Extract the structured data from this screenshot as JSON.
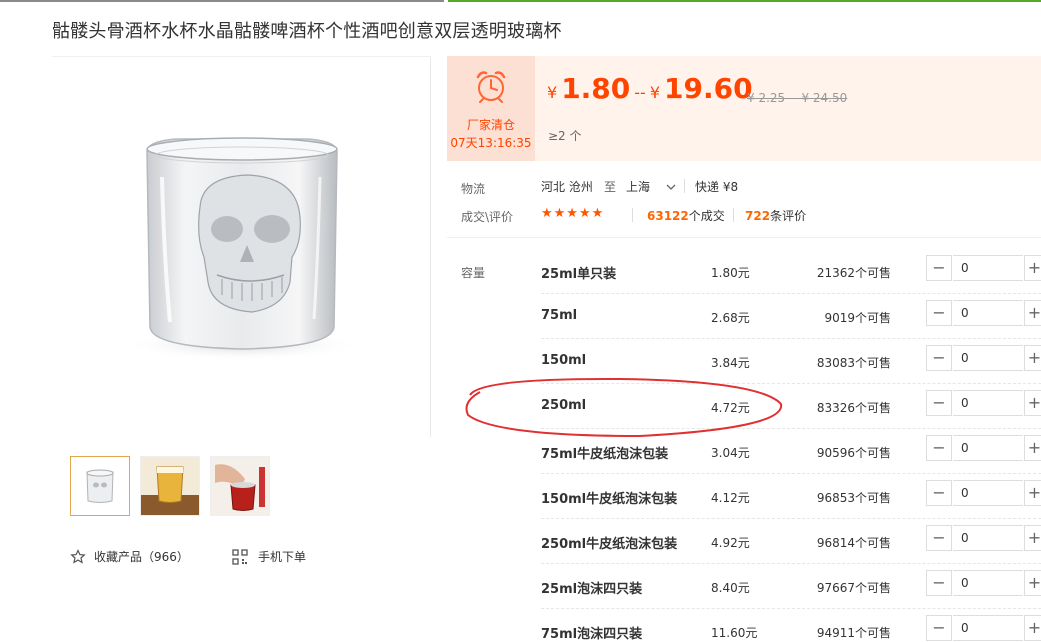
{
  "title": "骷髅头骨酒杯水杯水晶骷髅啤酒杯个性酒吧创意双层透明玻璃杯",
  "promo": {
    "label": "厂家清仓",
    "timer": "07天13:16:35",
    "icon": "alarm-clock-icon"
  },
  "price": {
    "currency": "¥",
    "low": "1.80",
    "separator": "--",
    "high": "19.60",
    "original": "¥ 2.25 -- ¥ 24.50",
    "min_order": "≥2 个"
  },
  "logistics": {
    "label": "物流",
    "origin": "河北 沧州",
    "to": "至",
    "destination": "上海",
    "method": "快递 ¥8"
  },
  "rating": {
    "label": "成交\\评价",
    "stars": "★★★★★",
    "deals_count": "63122",
    "deals_suffix": "个成交",
    "reviews_count": "722",
    "reviews_suffix": "条评价"
  },
  "sku": {
    "label": "容量",
    "rows": [
      {
        "name": "25ml单只装",
        "price": "1.80元",
        "stock": "21362个可售",
        "qty": "0"
      },
      {
        "name": "75ml",
        "price": "2.68元",
        "stock": "9019个可售",
        "qty": "0"
      },
      {
        "name": "150ml",
        "price": "3.84元",
        "stock": "83083个可售",
        "qty": "0"
      },
      {
        "name": "250ml",
        "price": "4.72元",
        "stock": "83326个可售",
        "qty": "0"
      },
      {
        "name": "75ml牛皮纸泡沫包装",
        "price": "3.04元",
        "stock": "90596个可售",
        "qty": "0"
      },
      {
        "name": "150ml牛皮纸泡沫包装",
        "price": "4.12元",
        "stock": "96853个可售",
        "qty": "0"
      },
      {
        "name": "250ml牛皮纸泡沫包装",
        "price": "4.92元",
        "stock": "96814个可售",
        "qty": "0"
      },
      {
        "name": "25ml泡沫四只装",
        "price": "8.40元",
        "stock": "97667个可售",
        "qty": "0"
      },
      {
        "name": "75ml泡沫四只装",
        "price": "11.60元",
        "stock": "94911个可售",
        "qty": "0"
      }
    ],
    "minus": "−",
    "plus": "+"
  },
  "actions": {
    "favorite": "收藏产品（966）",
    "mobile_order": "手机下单"
  },
  "colors": {
    "accent": "#ff4400",
    "annotation": "#e03030",
    "green": "#59a82a"
  }
}
